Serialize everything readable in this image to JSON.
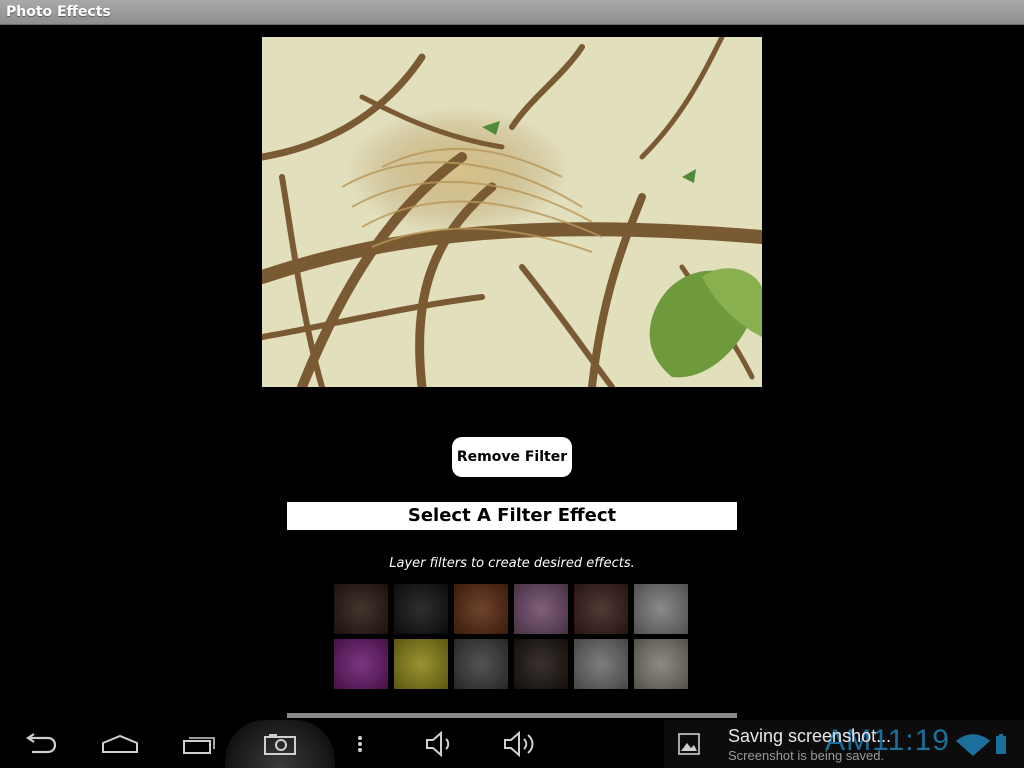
{
  "app": {
    "title": "Photo Effects"
  },
  "main": {
    "remove_filter_label": "Remove Filter",
    "section_title": "Select A Filter Effect",
    "hint": "Layer filters to create desired effects."
  },
  "filters": [
    {
      "color": "#2a1a12"
    },
    {
      "color": "#121212"
    },
    {
      "color": "#5a2a10"
    },
    {
      "color": "#6e4a68"
    },
    {
      "color": "#3a1e1a"
    },
    {
      "color": "#7a7a7a"
    },
    {
      "color": "#6a1a6e"
    },
    {
      "color": "#8c8418"
    },
    {
      "color": "#3c3c3c"
    },
    {
      "color": "#1e1612"
    },
    {
      "color": "#6c6c6c"
    },
    {
      "color": "#7e7c70"
    }
  ],
  "navbar": {
    "icons": [
      "back-icon",
      "home-icon",
      "recent-apps-icon",
      "screenshot-icon",
      "menu-icon",
      "volume-down-icon",
      "volume-up-icon"
    ]
  },
  "notification": {
    "title": "Saving screenshot...",
    "subtitle": "Screenshot is being saved.",
    "clock": "AM11:19"
  },
  "colors": {
    "background": "#000000",
    "accent": "#1b6f9a"
  }
}
